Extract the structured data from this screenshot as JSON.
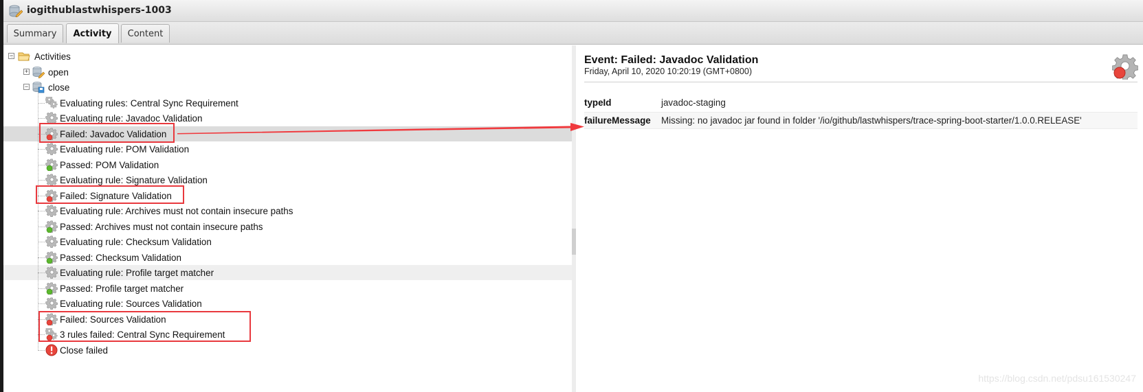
{
  "window": {
    "title": "iogithublastwhispers-1003",
    "title_icon": "repository-edit-icon"
  },
  "tabs": [
    {
      "label": "Summary",
      "active": false
    },
    {
      "label": "Activity",
      "active": true
    },
    {
      "label": "Content",
      "active": false
    }
  ],
  "tree": {
    "root": {
      "label": "Activities",
      "icon": "folder-open-icon",
      "expanded": true
    },
    "open": {
      "label": "open",
      "icon": "repository-edit-icon",
      "expanded": false
    },
    "close": {
      "label": "close",
      "icon": "repository-save-icon",
      "expanded": true
    },
    "events": [
      {
        "label": "Evaluating rules: Central Sync Requirement",
        "status": "evaluating-group"
      },
      {
        "label": "Evaluating rule: Javadoc Validation",
        "status": "evaluating"
      },
      {
        "label": "Failed: Javadoc Validation",
        "status": "failed",
        "selected": true
      },
      {
        "label": "Evaluating rule: POM Validation",
        "status": "evaluating"
      },
      {
        "label": "Passed: POM Validation",
        "status": "passed"
      },
      {
        "label": "Evaluating rule: Signature Validation",
        "status": "evaluating"
      },
      {
        "label": "Failed: Signature Validation",
        "status": "failed"
      },
      {
        "label": "Evaluating rule: Archives must not contain insecure paths",
        "status": "evaluating"
      },
      {
        "label": "Passed: Archives must not contain insecure paths",
        "status": "passed"
      },
      {
        "label": "Evaluating rule: Checksum Validation",
        "status": "evaluating"
      },
      {
        "label": "Passed: Checksum Validation",
        "status": "passed"
      },
      {
        "label": "Evaluating rule: Profile target matcher",
        "status": "evaluating",
        "hovered": true
      },
      {
        "label": "Passed: Profile target matcher",
        "status": "passed"
      },
      {
        "label": "Evaluating rule: Sources Validation",
        "status": "evaluating"
      },
      {
        "label": "Failed: Sources Validation",
        "status": "failed"
      },
      {
        "label": "3 rules failed: Central Sync Requirement",
        "status": "failed-group"
      },
      {
        "label": "Close failed",
        "status": "error"
      }
    ]
  },
  "event_detail": {
    "title": "Event: Failed: Javadoc Validation",
    "date": "Friday, April 10, 2020 10:20:19 (GMT+0800)",
    "icon": "gear-failed-icon",
    "properties": [
      {
        "key": "typeId",
        "value": "javadoc-staging"
      },
      {
        "key": "failureMessage",
        "value": "Missing: no javadoc jar found in folder '/io/github/lastwhispers/trace-spring-boot-starter/1.0.0.RELEASE'"
      }
    ]
  },
  "annotations": {
    "highlight_color": "#e8383d",
    "boxes": [
      "Failed: Javadoc Validation",
      "Failed: Signature Validation",
      "Failed: Sources Validation + 3 rules failed: Central Sync Requirement"
    ]
  },
  "watermark": "https://blog.csdn.net/pdsu161530247",
  "colors": {
    "selected_row": "#dcdcdc",
    "hover_row": "#efefef",
    "failed": "#e8453c",
    "passed": "#5cb82e",
    "gear": "#a8a8a8"
  }
}
